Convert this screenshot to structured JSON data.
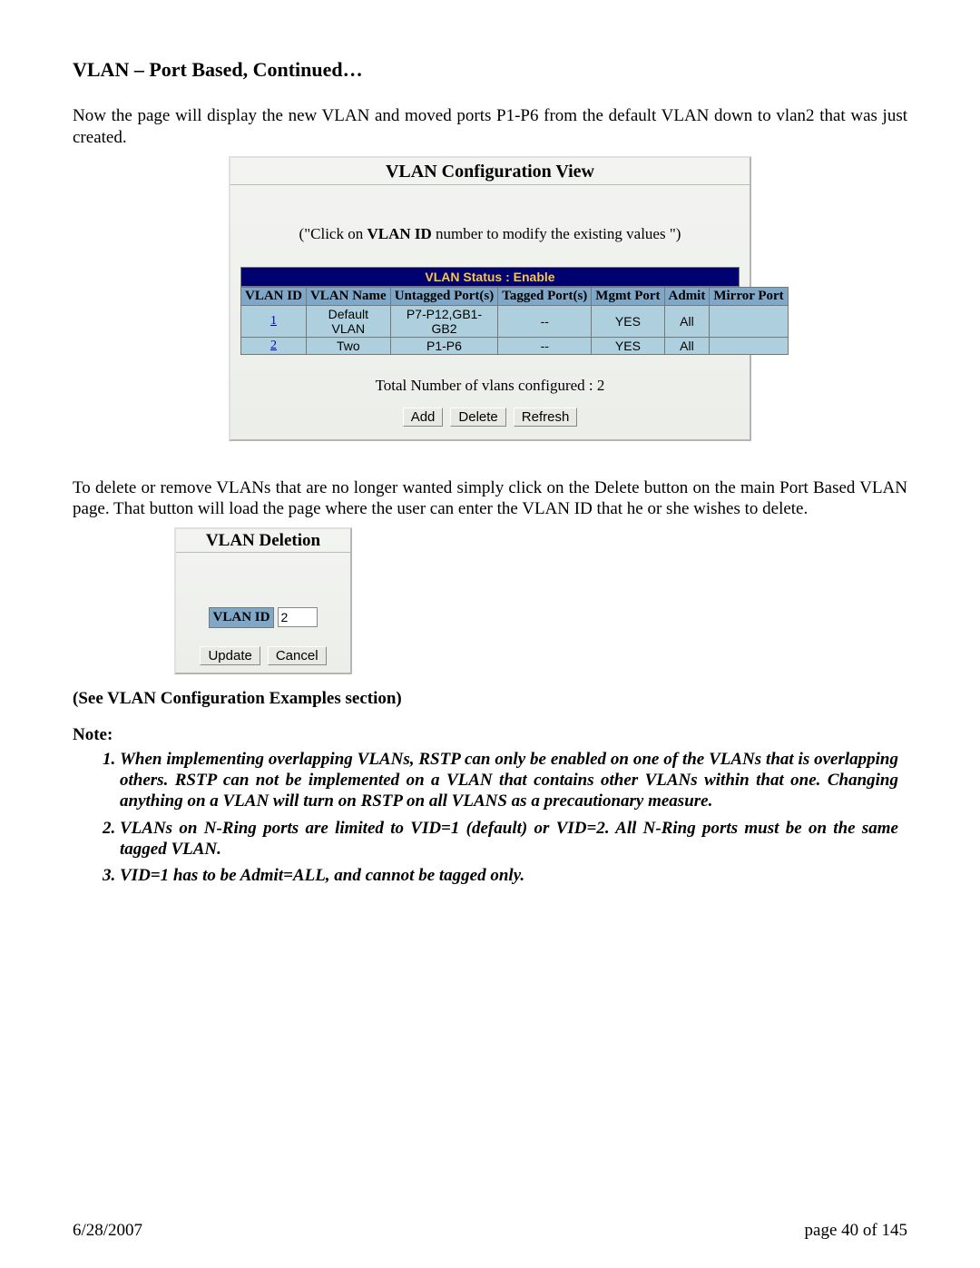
{
  "heading": "VLAN – Port Based, Continued…",
  "intro_paragraph": "Now the page will display the new VLAN and moved ports P1-P6 from the default VLAN down to vlan2 that was just created.",
  "config_view": {
    "title": "VLAN Configuration View",
    "hint_prefix": "(\"Click on ",
    "hint_bold": "VLAN ID",
    "hint_suffix": " number to modify the existing values \")",
    "vlan_status": "VLAN Status   :   Enable",
    "columns": [
      "VLAN ID",
      "VLAN Name",
      "Untagged Port(s)",
      "Tagged Port(s)",
      "Mgmt Port",
      "Admit",
      "Mirror Port"
    ],
    "rows": [
      {
        "id": "1",
        "name": "Default VLAN",
        "untagged": "P7-P12,GB1-GB2",
        "tagged": "--",
        "mgmt": "YES",
        "admit": "All",
        "mirror": ""
      },
      {
        "id": "2",
        "name": "Two",
        "untagged": "P1-P6",
        "tagged": "--",
        "mgmt": "YES",
        "admit": "All",
        "mirror": ""
      }
    ],
    "total_text": "Total Number of vlans configured : 2",
    "buttons": {
      "add": "Add",
      "delete": "Delete",
      "refresh": "Refresh"
    }
  },
  "delete_paragraph": "To delete or remove VLANs that are no longer wanted simply click on the Delete button on the main Port Based VLAN page.  That button will load the page where the user can enter the VLAN ID that he or she wishes to delete.",
  "deletion": {
    "title": "VLAN Deletion",
    "label": "VLAN ID",
    "value": "2",
    "buttons": {
      "update": "Update",
      "cancel": "Cancel"
    }
  },
  "see_section": "(See VLAN Configuration Examples section)",
  "note_label": "Note:",
  "notes": [
    "When implementing overlapping VLANs, RSTP can only be enabled on one of the VLANs that is overlapping others.  RSTP can not be implemented on a VLAN that contains other VLANs within that one.  Changing anything on a VLAN will turn on RSTP on all VLANS as a precautionary measure.",
    "VLANs on N-Ring ports are limited to VID=1 (default) or VID=2.  All N-Ring ports must be on the same tagged VLAN.",
    "VID=1 has to be Admit=ALL, and cannot be tagged only."
  ],
  "footer": {
    "date": "6/28/2007",
    "page": "page 40 of 145"
  }
}
